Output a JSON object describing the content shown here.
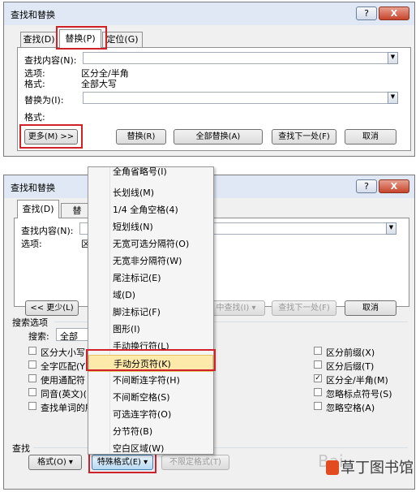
{
  "dialog1": {
    "title": "查找和替换",
    "help_btn": "?",
    "close_btn": "X",
    "tabs": [
      "查找(D)",
      "替换(P)",
      "定位(G)"
    ],
    "find_label": "查找内容(N):",
    "options_label": "选项:",
    "options_value": "区分全/半角",
    "format_label": "格式:",
    "format_value": "全部大写",
    "replace_label": "替换为(I):",
    "replace_format_label": "格式:",
    "buttons": [
      "更多(M) >>",
      "替换(R)",
      "全部替换(A)",
      "查找下一处(F)",
      "取消"
    ]
  },
  "dialog2": {
    "title": "查找和替换",
    "help_btn": "?",
    "close_btn": "X",
    "tabs": [
      "查找(D)",
      "替"
    ],
    "find_label": "查找内容(N):",
    "options_label": "选项:",
    "options_value": "区",
    "less_btn": "<< 更少(L)",
    "find_in_btn": "中查找(I) ▾",
    "find_next_btn": "查找下一处(F)",
    "cancel_btn": "取消",
    "search_options_label": "搜索选项",
    "search_label": "搜索:",
    "search_value": "全部",
    "left_options": [
      "区分大小写",
      "全字匹配(Y)",
      "使用通配符",
      "同音(英文)(",
      "查找单词的所"
    ],
    "right_options": [
      {
        "label": "区分前缀(X)",
        "checked": false
      },
      {
        "label": "区分后缀(T)",
        "checked": false
      },
      {
        "label": "区分全/半角(M)",
        "checked": true
      },
      {
        "label": "忽略标点符号(S)",
        "checked": false
      },
      {
        "label": "忽略空格(A)",
        "checked": false
      }
    ],
    "find_group_label": "查找",
    "format_btn": "格式(O) ▾",
    "special_btn": "特殊格式(E) ▾",
    "no_format_btn": "不限定格式(T)"
  },
  "menu": {
    "items": [
      "全角省略号(I)",
      "长划线(M)",
      "1/4 全角空格(4)",
      "短划线(N)",
      "无宽可选分隔符(O)",
      "无宽非分隔符(W)",
      "尾注标记(E)",
      "域(D)",
      "脚注标记(F)",
      "图形(I)",
      "手动换行符(L)",
      "手动分页符(K)",
      "不间断连字符(H)",
      "不间断空格(S)",
      "可选连字符(O)",
      "分节符(B)",
      "空白区域(W)"
    ],
    "selected_index": 11
  },
  "watermark": {
    "faded_text": "Bai",
    "brand_text": "草丁图书馆"
  }
}
